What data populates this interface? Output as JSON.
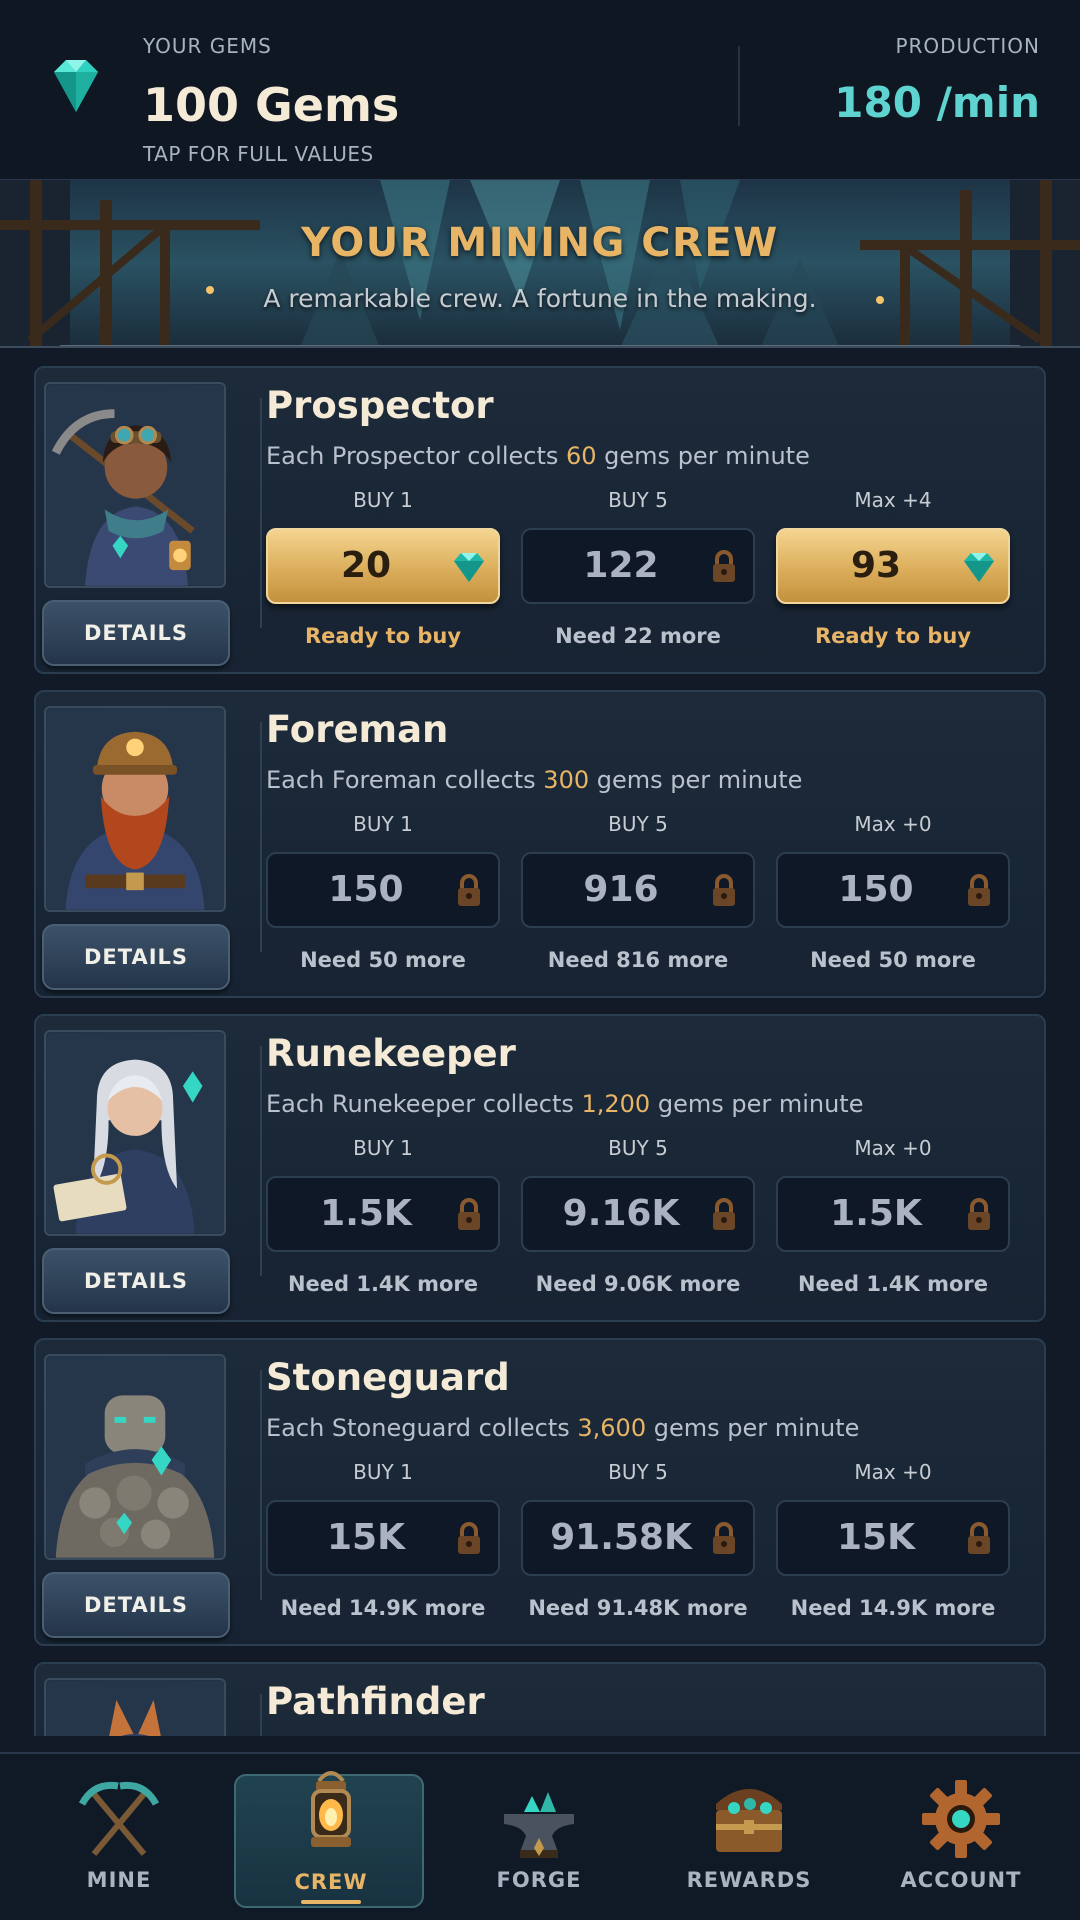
{
  "header": {
    "gems_caption": "YOUR GEMS",
    "gems_value": "100 Gems",
    "gems_hint": "TAP FOR FULL VALUES",
    "production_caption": "PRODUCTION",
    "production_value": "180 /min",
    "icon": "gem-icon"
  },
  "banner": {
    "title": "YOUR MINING CREW",
    "subtitle": "A remarkable crew. A fortune in the making."
  },
  "crew": [
    {
      "name": "Prospector",
      "desc_prefix": "Each Prospector collects ",
      "rate": "60",
      "desc_suffix": " gems per minute",
      "details_label": "DETAILS",
      "options": [
        {
          "label": "BUY 1",
          "price": "20",
          "state": "ready",
          "icon": "gem-icon",
          "status": "Ready to buy"
        },
        {
          "label": "BUY 5",
          "price": "122",
          "state": "locked",
          "icon": "lock-icon",
          "status": "Need 22 more"
        },
        {
          "label": "Max +4",
          "price": "93",
          "state": "ready",
          "icon": "gem-icon",
          "status": "Ready to buy"
        }
      ]
    },
    {
      "name": "Foreman",
      "desc_prefix": "Each Foreman collects ",
      "rate": "300",
      "desc_suffix": " gems per minute",
      "details_label": "DETAILS",
      "options": [
        {
          "label": "BUY 1",
          "price": "150",
          "state": "locked",
          "icon": "lock-icon",
          "status": "Need 50 more"
        },
        {
          "label": "BUY 5",
          "price": "916",
          "state": "locked",
          "icon": "lock-icon",
          "status": "Need 816 more"
        },
        {
          "label": "Max +0",
          "price": "150",
          "state": "locked",
          "icon": "lock-icon",
          "status": "Need 50 more"
        }
      ]
    },
    {
      "name": "Runekeeper",
      "desc_prefix": "Each Runekeeper collects ",
      "rate": "1,200",
      "desc_suffix": " gems per minute",
      "details_label": "DETAILS",
      "options": [
        {
          "label": "BUY 1",
          "price": "1.5K",
          "state": "locked",
          "icon": "lock-icon",
          "status": "Need 1.4K more"
        },
        {
          "label": "BUY 5",
          "price": "9.16K",
          "state": "locked",
          "icon": "lock-icon",
          "status": "Need 9.06K more"
        },
        {
          "label": "Max +0",
          "price": "1.5K",
          "state": "locked",
          "icon": "lock-icon",
          "status": "Need 1.4K more"
        }
      ]
    },
    {
      "name": "Stoneguard",
      "desc_prefix": "Each Stoneguard collects ",
      "rate": "3,600",
      "desc_suffix": " gems per minute",
      "details_label": "DETAILS",
      "options": [
        {
          "label": "BUY 1",
          "price": "15K",
          "state": "locked",
          "icon": "lock-icon",
          "status": "Need 14.9K more"
        },
        {
          "label": "BUY 5",
          "price": "91.58K",
          "state": "locked",
          "icon": "lock-icon",
          "status": "Need 91.48K more"
        },
        {
          "label": "Max +0",
          "price": "15K",
          "state": "locked",
          "icon": "lock-icon",
          "status": "Need 14.9K more"
        }
      ]
    },
    {
      "name": "Pathfinder"
    }
  ],
  "nav": [
    {
      "label": "MINE",
      "icon": "crossed-pickaxes-icon",
      "active": false
    },
    {
      "label": "CREW",
      "icon": "lantern-icon",
      "active": true
    },
    {
      "label": "FORGE",
      "icon": "anvil-icon",
      "active": false
    },
    {
      "label": "REWARDS",
      "icon": "treasure-chest-icon",
      "active": false
    },
    {
      "label": "ACCOUNT",
      "icon": "gear-icon",
      "active": false
    }
  ],
  "colors": {
    "accent_gold": "#e8b465",
    "accent_teal": "#5fd3d0",
    "background": "#111a26"
  }
}
